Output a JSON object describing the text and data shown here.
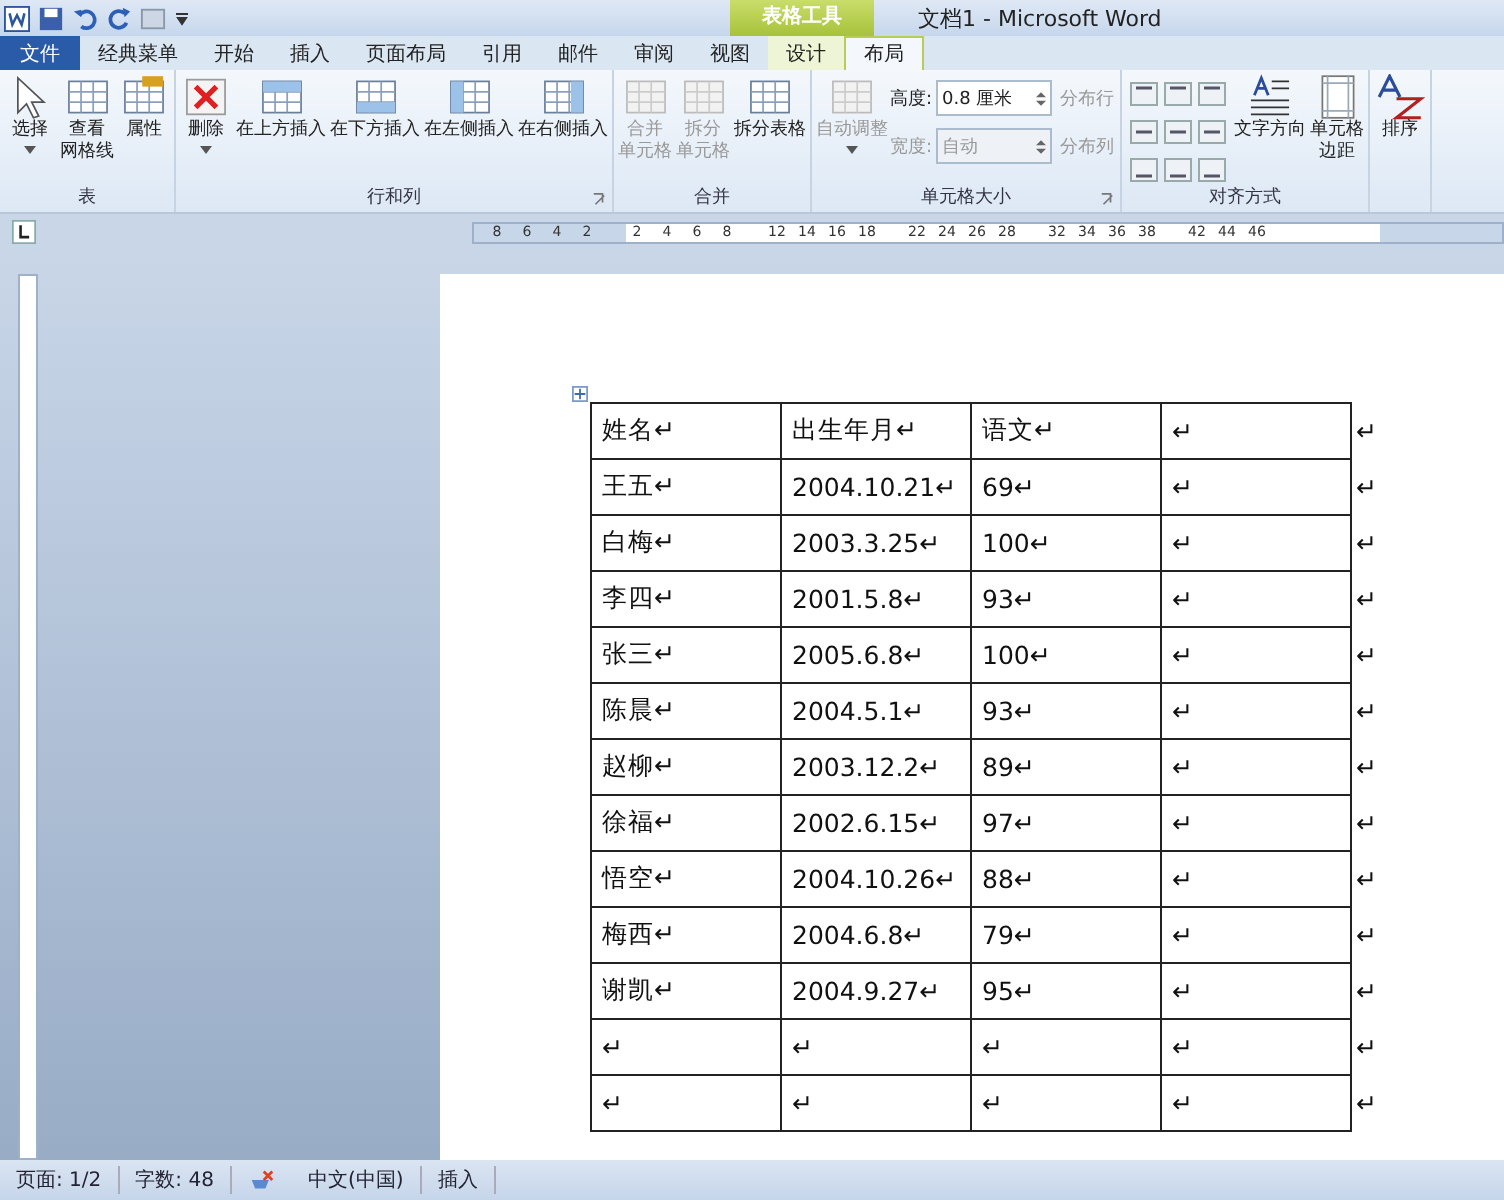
{
  "window": {
    "title": "文档1 - Microsoft Word",
    "context_group": "表格工具"
  },
  "tabs": [
    {
      "label": "文件",
      "kind": "file",
      "selected": false
    },
    {
      "label": "经典菜单",
      "kind": "normal",
      "selected": false
    },
    {
      "label": "开始",
      "kind": "normal",
      "selected": false
    },
    {
      "label": "插入",
      "kind": "normal",
      "selected": false
    },
    {
      "label": "页面布局",
      "kind": "normal",
      "selected": false
    },
    {
      "label": "引用",
      "kind": "normal",
      "selected": false
    },
    {
      "label": "邮件",
      "kind": "normal",
      "selected": false
    },
    {
      "label": "审阅",
      "kind": "normal",
      "selected": false
    },
    {
      "label": "视图",
      "kind": "normal",
      "selected": false
    },
    {
      "label": "设计",
      "kind": "context",
      "selected": false
    },
    {
      "label": "布局",
      "kind": "context",
      "selected": true
    }
  ],
  "ribbon_groups": [
    {
      "label": "表",
      "items": [
        {
          "kind": "large",
          "label": "选择",
          "disabled": false,
          "dropdown": true
        },
        {
          "kind": "large",
          "lines": [
            "查看",
            "网格线"
          ],
          "disabled": false
        },
        {
          "kind": "large",
          "label": "属性",
          "disabled": false
        }
      ]
    },
    {
      "label": "行和列",
      "launcher": true,
      "items": [
        {
          "kind": "large",
          "label": "删除",
          "disabled": false,
          "dropdown": true
        },
        {
          "kind": "large",
          "label": "在上方插入",
          "disabled": false
        },
        {
          "kind": "large",
          "label": "在下方插入",
          "disabled": false
        },
        {
          "kind": "large",
          "label": "在左侧插入",
          "disabled": false
        },
        {
          "kind": "large",
          "label": "在右侧插入",
          "disabled": false
        }
      ]
    },
    {
      "label": "合并",
      "items": [
        {
          "kind": "large",
          "lines": [
            "合并",
            "单元格"
          ],
          "disabled": true
        },
        {
          "kind": "large",
          "lines": [
            "拆分",
            "单元格"
          ],
          "disabled": true
        },
        {
          "kind": "large",
          "label": "拆分表格",
          "disabled": false
        }
      ]
    },
    {
      "label": "单元格大小",
      "launcher": true,
      "items": [
        {
          "kind": "large",
          "label": "自动调整",
          "disabled": true,
          "dropdown": true
        },
        {
          "kind": "fields",
          "fields": [
            {
              "label": "高度:",
              "value": "0.8 厘米",
              "disabled": false
            },
            {
              "label": "宽度:",
              "value": "自动",
              "disabled": true
            }
          ],
          "buttons": [
            {
              "label": "分布行",
              "disabled": true
            },
            {
              "label": "分布列",
              "disabled": true
            }
          ]
        }
      ]
    },
    {
      "label": "对齐方式",
      "items": [
        {
          "kind": "align-grid"
        },
        {
          "kind": "large",
          "label": "文字方向",
          "disabled": false
        },
        {
          "kind": "large",
          "lines": [
            "单元格",
            "边距"
          ],
          "disabled": false
        }
      ]
    },
    {
      "items": [
        {
          "kind": "large",
          "label": "排序",
          "disabled": false
        }
      ]
    }
  ],
  "ruler": [
    "8",
    "6",
    "4",
    "2",
    "2",
    "4",
    "6",
    "8",
    "12",
    "14",
    "16",
    "18",
    "22",
    "24",
    "26",
    "28",
    "32",
    "34",
    "36",
    "38",
    "42",
    "44",
    "46"
  ],
  "table": {
    "rows": [
      {
        "cells": [
          "姓名↵",
          "出生年月↵",
          "语文↵",
          "↵"
        ],
        "end_mark": "↵"
      },
      {
        "cells": [
          "王五↵",
          "2004.10.21↵",
          "69↵",
          "↵"
        ],
        "end_mark": "↵"
      },
      {
        "cells": [
          "白梅↵",
          "2003.3.25↵",
          "100↵",
          "↵"
        ],
        "end_mark": "↵"
      },
      {
        "cells": [
          "李四↵",
          "2001.5.8↵",
          "93↵",
          "↵"
        ],
        "end_mark": "↵"
      },
      {
        "cells": [
          "张三↵",
          "2005.6.8↵",
          "100↵",
          "↵"
        ],
        "end_mark": "↵"
      },
      {
        "cells": [
          "陈晨↵",
          "2004.5.1↵",
          "93↵",
          "↵"
        ],
        "end_mark": "↵"
      },
      {
        "cells": [
          "赵柳↵",
          "2003.12.2↵",
          "89↵",
          "↵"
        ],
        "end_mark": "↵"
      },
      {
        "cells": [
          "徐福↵",
          "2002.6.15↵",
          "97↵",
          "↵"
        ],
        "end_mark": "↵"
      },
      {
        "cells": [
          "悟空↵",
          "2004.10.26↵",
          "88↵",
          "↵"
        ],
        "end_mark": "↵"
      },
      {
        "cells": [
          "梅西↵",
          "2004.6.8↵",
          "79↵",
          "↵"
        ],
        "end_mark": "↵"
      },
      {
        "cells": [
          "谢凯↵",
          "2004.9.27↵",
          "95↵",
          "↵"
        ],
        "end_mark": "↵"
      },
      {
        "cells": [
          "↵",
          "↵",
          "↵",
          "↵"
        ],
        "end_mark": "↵"
      },
      {
        "cells": [
          "↵",
          "↵",
          "↵",
          "↵"
        ],
        "end_mark": "↵"
      }
    ]
  },
  "status_bar": [
    {
      "kind": "text",
      "label": "页面: 1/2"
    },
    {
      "kind": "text",
      "label": "字数: 48"
    },
    {
      "kind": "proofing"
    },
    {
      "kind": "text",
      "label": "中文(中国)"
    },
    {
      "kind": "text",
      "label": "插入"
    }
  ]
}
